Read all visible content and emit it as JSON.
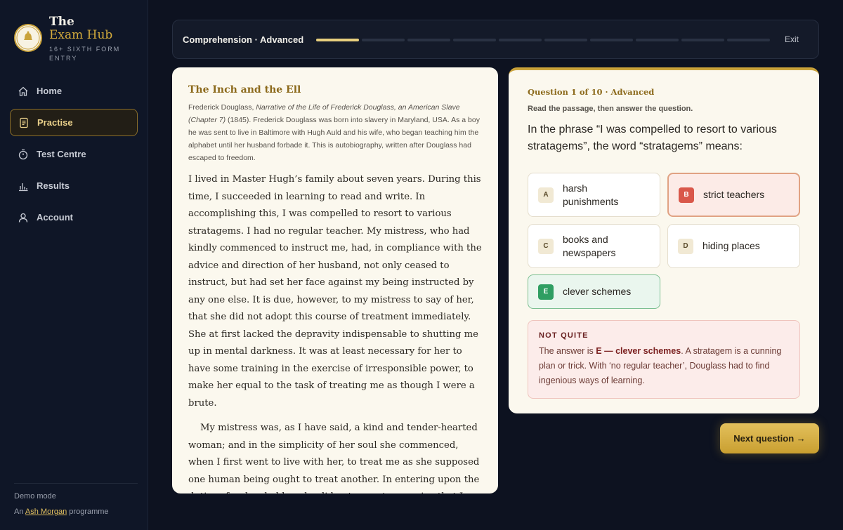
{
  "brand": {
    "line1": "The",
    "line2": "Exam Hub",
    "subtitle": "16+ SIXTH FORM ENTRY",
    "logo_text": "Ash Morgan"
  },
  "nav": [
    {
      "label": "Home",
      "icon": "home-icon",
      "active": false
    },
    {
      "label": "Practise",
      "icon": "document-icon",
      "active": true
    },
    {
      "label": "Test Centre",
      "icon": "stopwatch-icon",
      "active": false
    },
    {
      "label": "Results",
      "icon": "bar-chart-icon",
      "active": false
    },
    {
      "label": "Account",
      "icon": "user-icon",
      "active": false
    }
  ],
  "footer": {
    "demo": "Demo mode",
    "prog_prefix": "An",
    "prog_link": "Ash Morgan",
    "prog_suffix": "programme"
  },
  "topbar": {
    "crumb": "Comprehension · Advanced",
    "progress_done": 1,
    "progress_total": 10,
    "exit_label": "Exit"
  },
  "passage": {
    "title": "The Inch and the Ell",
    "source_author": "Frederick Douglass,",
    "source_work": "Narrative of the Life of Frederick Douglass, an American Slave (Chapter 7)",
    "source_rest": "(1845). Frederick Douglass was born into slavery in Maryland, USA. As a boy he was sent to live in Baltimore with Hugh Auld and his wife, who began teaching him the alphabet until her husband forbade it. This is autobiography, written after Douglass had escaped to freedom.",
    "paragraphs": [
      "I lived in Master Hugh’s family about seven years. During this time, I succeeded in learning to read and write. In accomplishing this, I was compelled to resort to various stratagems. I had no regular teacher. My mistress, who had kindly commenced to instruct me, had, in compliance with the advice and direction of her husband, not only ceased to instruct, but had set her face against my being instructed by any one else. It is due, however, to my mistress to say of her, that she did not adopt this course of treatment immediately. She at first lacked the depravity indispensable to shutting me up in mental darkness. It was at least necessary for her to have some training in the exercise of irresponsible power, to make her equal to the task of treating me as though I were a brute.",
      "My mistress was, as I have said, a kind and tender-hearted woman; and in the simplicity of her soul she commenced, when I first went to live with her, to treat me as she supposed one human being ought to treat another. In entering upon the duties of a slaveholder, she did not seem to perceive that I sustained to"
    ]
  },
  "question": {
    "number": "Question 1 of 10 · Advanced",
    "instruction": "Read the passage, then answer the question.",
    "text": "In the phrase “I was compelled to resort to various stratagems”, the word “stratagems” means:",
    "options": [
      {
        "letter": "A",
        "text": "harsh punishments",
        "state": "default"
      },
      {
        "letter": "B",
        "text": "strict teachers",
        "state": "wrong"
      },
      {
        "letter": "C",
        "text": "books and newspapers",
        "state": "default"
      },
      {
        "letter": "D",
        "text": "hiding places",
        "state": "default"
      },
      {
        "letter": "E",
        "text": "clever schemes",
        "state": "correct"
      }
    ],
    "feedback": {
      "heading": "NOT QUITE",
      "prefix": "The answer is ",
      "answer": "E — clever schemes",
      "explanation": ". A stratagem is a cunning plan or trick. With ‘no regular teacher’, Douglass had to find ingenious ways of learning."
    },
    "next_label": "Next question →"
  },
  "colors": {
    "accent_gold": "#c9a23a",
    "wrong": "#d9574a",
    "correct": "#2f9e62",
    "background": "#0d1220"
  }
}
